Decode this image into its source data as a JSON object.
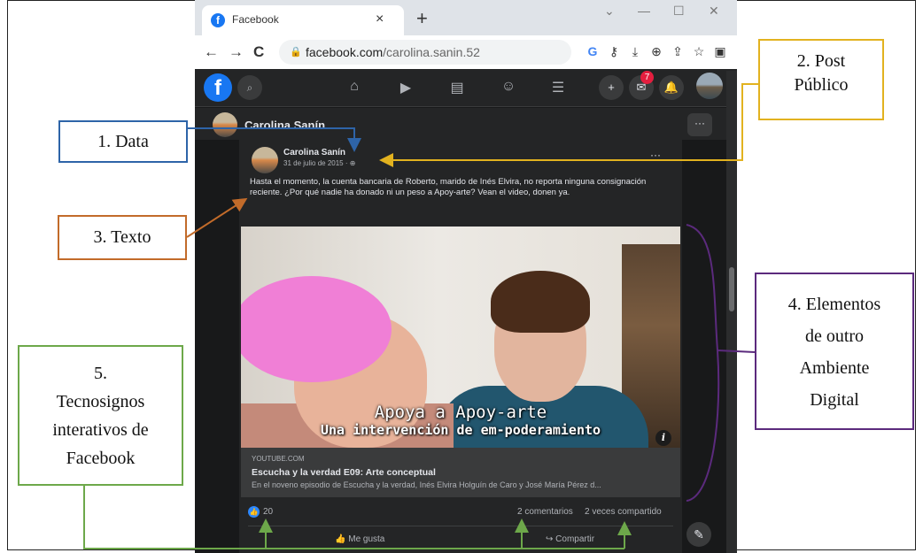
{
  "browser": {
    "tab_title": "Facebook",
    "tab_close": "×",
    "new_tab": "+",
    "url_host": "facebook.com",
    "url_path": "/carolina.sanin.52",
    "back": "←",
    "forward": "→",
    "reload": "C",
    "minimize": "—",
    "maximize": "☐",
    "close": "✕"
  },
  "fb": {
    "messenger_badge": "7",
    "page_name": "Carolina Sanín",
    "more": "···"
  },
  "post": {
    "author": "Carolina Sanín",
    "date": "31 de julio de 2015",
    "privacy_icon": "globe-icon",
    "more": "···",
    "text": "Hasta el momento, la cuenta bancaria de Roberto, marido de Inés Elvira, no reporta ninguna consignación reciente. ¿Por qué nadie ha donado ni un peso a Apoy-arte? Vean el video, donen ya.",
    "video_caption_1": "Apoya a Apoy-arte",
    "video_caption_2": "Una intervención de em-poderamiento",
    "link_source": "YOUTUBE.COM",
    "link_title": "Escucha y la verdad E09: Arte conceptual",
    "link_desc": "En el noveno episodio de Escucha y la verdad, Inés Elvira Holguín de Caro y José María Pérez d...",
    "likes": "20",
    "comments": "2 comentarios",
    "shares": "2 veces compartido",
    "like_action": "Me gusta",
    "share_action": "Compartir"
  },
  "annotations": {
    "a1": "1. Data",
    "a2_line1": "2. Post",
    "a2_line2": "Público",
    "a3": "3. Texto",
    "a4_line1": "4. Elementos",
    "a4_line2": "de outro",
    "a4_line3": "Ambiente",
    "a4_line4": "Digital",
    "a5_line1": "5.",
    "a5_line2": "Tecnosignos",
    "a5_line3": "interativos de",
    "a5_line4": "Facebook"
  },
  "colors": {
    "annot_blue": "#2e64a8",
    "annot_yellow": "#e2b21f",
    "annot_orange": "#c26b2a",
    "annot_purple": "#5b2a7d",
    "annot_green": "#6da84a",
    "fb_blue": "#1877f2"
  }
}
